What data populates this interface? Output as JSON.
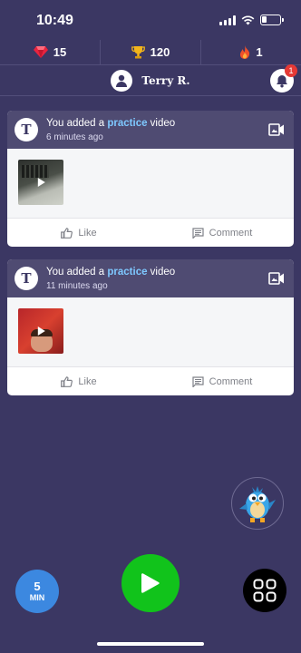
{
  "status_bar": {
    "time": "10:49"
  },
  "stats": {
    "gems": "15",
    "trophies": "120",
    "streak": "1"
  },
  "profile": {
    "name": "Terry R.",
    "notification_count": "1"
  },
  "feed": [
    {
      "avatar_letter": "T",
      "title_prefix": "You added a ",
      "title_highlight": "practice",
      "title_suffix": " video",
      "time": "6 minutes ago",
      "like_label": "Like",
      "comment_label": "Comment"
    },
    {
      "avatar_letter": "T",
      "title_prefix": "You added a ",
      "title_highlight": "practice",
      "title_suffix": " video",
      "time": "11 minutes ago",
      "like_label": "Like",
      "comment_label": "Comment"
    }
  ],
  "bottom": {
    "timer_value": "5",
    "timer_unit": "MIN"
  },
  "icons": {
    "gem": "gem-icon",
    "trophy": "trophy-icon",
    "streak": "flame-icon",
    "profile": "user-icon",
    "notifications": "bell-icon",
    "video": "video-camera-icon",
    "like": "thumbs-up-icon",
    "comment": "comment-icon",
    "play": "play-icon",
    "menu": "grid-icon",
    "mascot": "bird-mascot-icon"
  },
  "colors": {
    "background": "#3b3763",
    "card_header": "#4f4b72",
    "highlight": "#7ec8ff",
    "play_button": "#11c31b",
    "timer_button": "#3c88e0",
    "badge": "#e53935"
  }
}
